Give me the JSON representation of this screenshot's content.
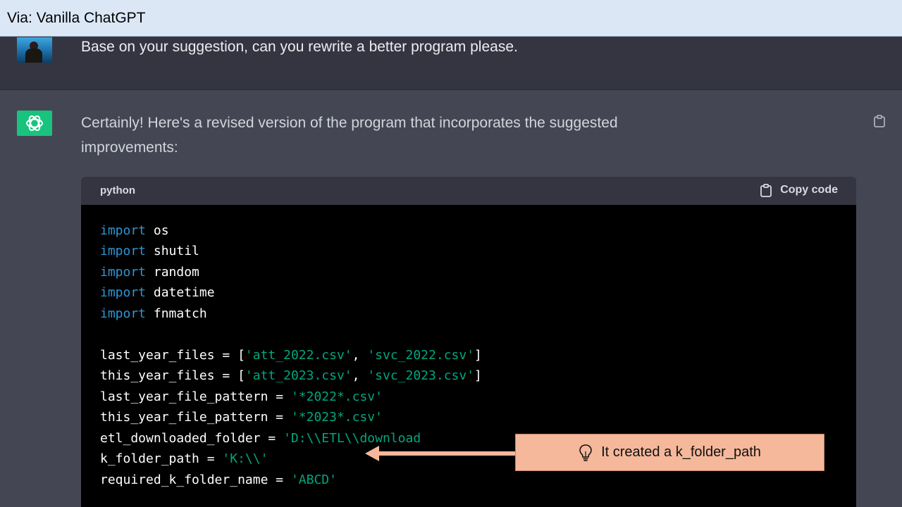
{
  "window": {
    "title": "Via: Vanilla ChatGPT"
  },
  "user_message": {
    "text": "Base on your suggestion, can you rewrite a better program please."
  },
  "assistant_message": {
    "line1": "Certainly! Here's a revised version of the program that incorporates the suggested",
    "line2": "improvements:"
  },
  "code_block": {
    "language": "python",
    "copy_label": "Copy code",
    "imports": [
      {
        "kw": "import",
        "name": "os"
      },
      {
        "kw": "import",
        "name": "shutil"
      },
      {
        "kw": "import",
        "name": "random"
      },
      {
        "kw": "import",
        "name": "datetime"
      },
      {
        "kw": "import",
        "name": "fnmatch"
      }
    ],
    "assignments": [
      {
        "name": "last_year_files",
        "op": " = [",
        "s1": "'att_2022.csv'",
        "sep": ", ",
        "s2": "'svc_2022.csv'",
        "end": "]"
      },
      {
        "name": "this_year_files",
        "op": " = [",
        "s1": "'att_2023.csv'",
        "sep": ", ",
        "s2": "'svc_2023.csv'",
        "end": "]"
      },
      {
        "name": "last_year_file_pattern",
        "op": " = ",
        "s1": "'*2022*.csv'"
      },
      {
        "name": "this_year_file_pattern",
        "op": " = ",
        "s1": "'*2023*.csv'"
      },
      {
        "name": "etl_downloaded_folder",
        "op": " = ",
        "s1": "'D:\\\\ETL\\\\download"
      },
      {
        "name": "k_folder_path",
        "op": " = ",
        "s1": "'K:\\\\'"
      },
      {
        "name": "required_k_folder_name",
        "op": " = ",
        "s1": "'ABCD'"
      }
    ]
  },
  "callout": {
    "text": "It created a k_folder_path",
    "icon": "lightbulb-icon",
    "color": "#f5b89b"
  },
  "colors": {
    "keyword": "#2e95d3",
    "string": "#00a67d",
    "gpt_green": "#19c37d"
  }
}
